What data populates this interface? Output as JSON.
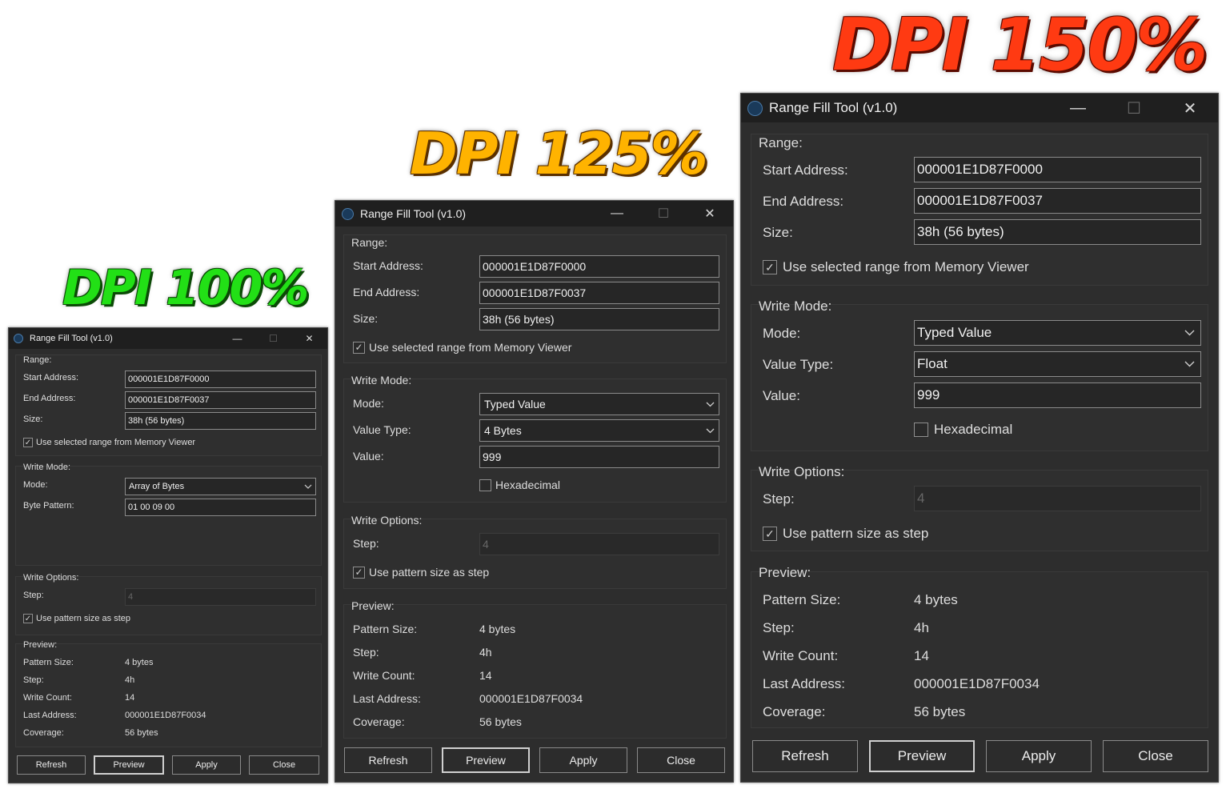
{
  "banners": {
    "dpi100": "DPI 100%",
    "dpi125": "DPI 125%",
    "dpi150": "DPI 150%"
  },
  "window": {
    "title": "Range Fill Tool (v1.0)",
    "minimize_glyph": "—",
    "maximize_glyph": "☐",
    "close_glyph": "✕"
  },
  "range": {
    "group": "Range:",
    "start_label": "Start Address:",
    "start_value": "000001E1D87F0000",
    "end_label": "End Address:",
    "end_value": "000001E1D87F0037",
    "size_label": "Size:",
    "size_value": "38h (56 bytes)",
    "use_selected_label": "Use selected range from Memory Viewer",
    "use_selected_checked": true
  },
  "write_mode": {
    "group": "Write Mode:",
    "mode_label": "Mode:",
    "value_type_label": "Value Type:",
    "value_label": "Value:",
    "byte_pattern_label": "Byte Pattern:",
    "hex_label": "Hexadecimal",
    "hex_checked": false,
    "w100": {
      "mode": "Array of Bytes",
      "byte_pattern": "01 00 09 00"
    },
    "w125": {
      "mode": "Typed Value",
      "value_type": "4 Bytes",
      "value": "999"
    },
    "w150": {
      "mode": "Typed Value",
      "value_type": "Float",
      "value": "999"
    }
  },
  "write_options": {
    "group": "Write Options:",
    "step_label": "Step:",
    "step_value": "4",
    "use_pattern_label": "Use pattern size as step",
    "use_pattern_checked": true
  },
  "preview": {
    "group": "Preview:",
    "pattern_size_label": "Pattern Size:",
    "pattern_size": "4 bytes",
    "step_label": "Step:",
    "step": "4h",
    "write_count_label": "Write Count:",
    "write_count": "14",
    "last_address_label": "Last Address:",
    "last_address": "000001E1D87F0034",
    "coverage_label": "Coverage:",
    "coverage": "56 bytes"
  },
  "buttons": {
    "refresh": "Refresh",
    "preview": "Preview",
    "apply": "Apply",
    "close": "Close"
  },
  "icons": {
    "app": "app-icon",
    "checkmark": "✓",
    "chevron": "⌄"
  }
}
